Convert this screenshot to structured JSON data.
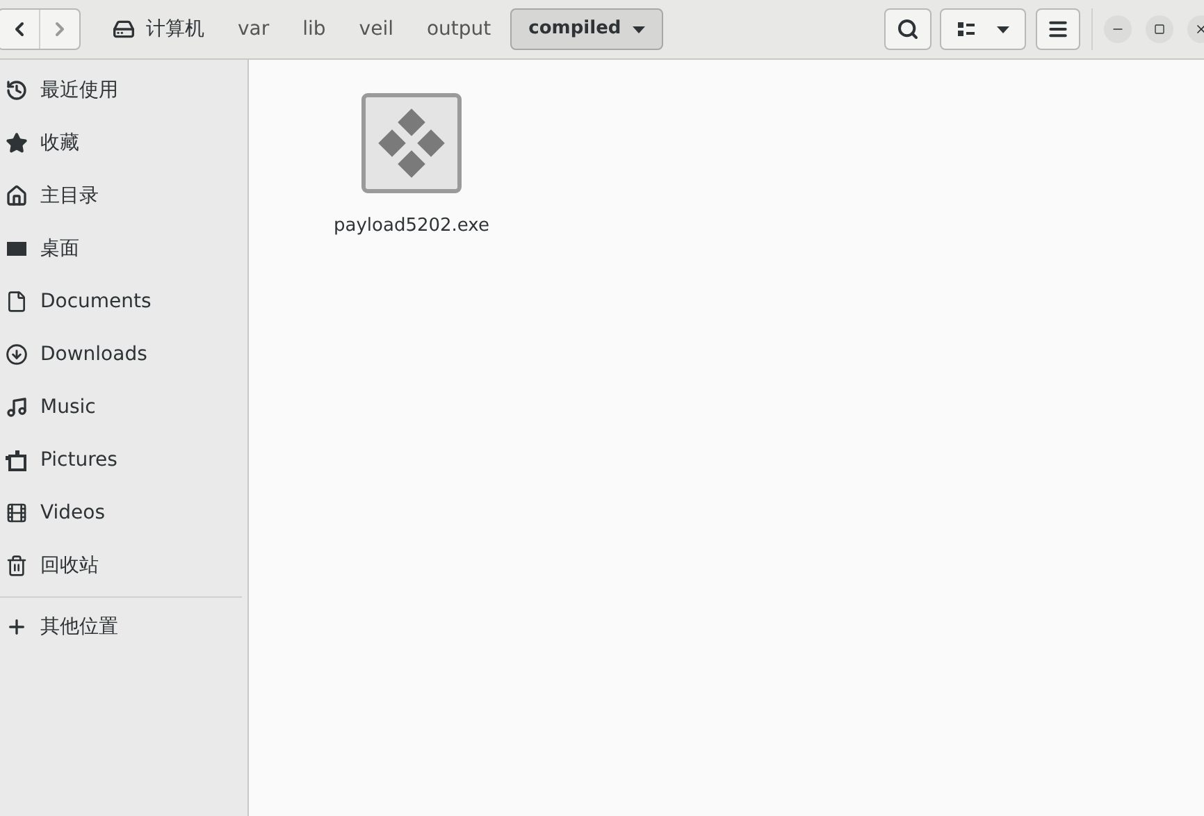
{
  "breadcrumbs": [
    {
      "label": "计算机",
      "kind": "root",
      "selected": false
    },
    {
      "label": "var",
      "kind": "folder",
      "selected": false
    },
    {
      "label": "lib",
      "kind": "folder",
      "selected": false
    },
    {
      "label": "veil",
      "kind": "folder",
      "selected": false
    },
    {
      "label": "output",
      "kind": "folder",
      "selected": false
    },
    {
      "label": "compiled",
      "kind": "folder",
      "selected": true
    }
  ],
  "sidebar": {
    "items": [
      {
        "label": "最近使用",
        "kind": "recent"
      },
      {
        "label": "收藏",
        "kind": "starred"
      },
      {
        "label": "主目录",
        "kind": "home"
      },
      {
        "label": "桌面",
        "kind": "desktop"
      },
      {
        "label": "Documents",
        "kind": "documents"
      },
      {
        "label": "Downloads",
        "kind": "downloads"
      },
      {
        "label": "Music",
        "kind": "music"
      },
      {
        "label": "Pictures",
        "kind": "pictures"
      },
      {
        "label": "Videos",
        "kind": "videos"
      },
      {
        "label": "回收站",
        "kind": "trash"
      }
    ],
    "other": {
      "label": "其他位置",
      "kind": "add"
    }
  },
  "files": [
    {
      "name": "payload5202.exe",
      "kind": "executable"
    }
  ]
}
